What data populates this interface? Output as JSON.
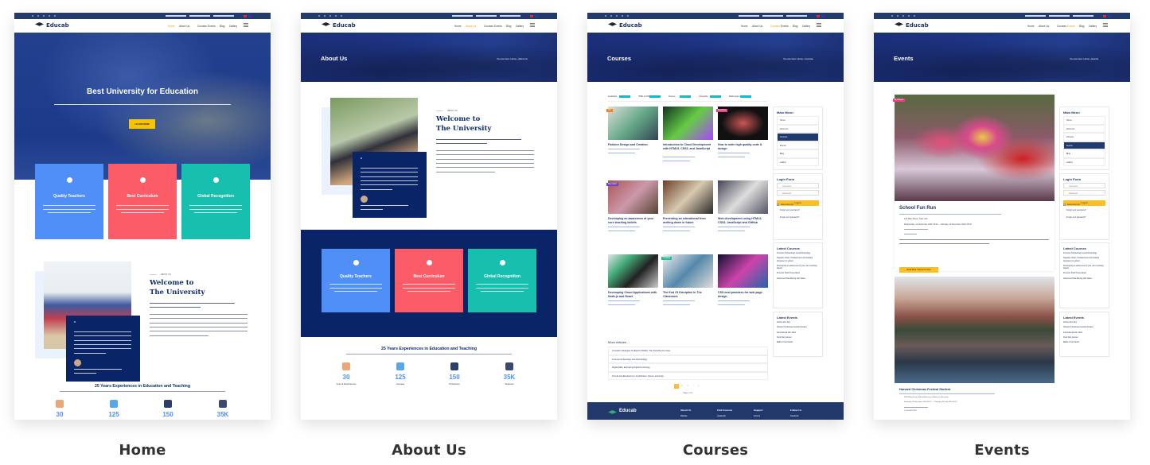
{
  "site": {
    "logo": "Educab",
    "nav": [
      "Home",
      "About Us",
      "Courses",
      "Events",
      "Blog",
      "Gallery"
    ],
    "colors": {
      "navy": "#233a6b",
      "dark_blue": "#0a2468",
      "accent_yellow": "#fbbf24",
      "blue": "#4f8ff7",
      "red": "#fb5c67",
      "teal": "#17bfae"
    }
  },
  "captions": [
    "Home",
    "About Us",
    "Courses",
    "Events"
  ],
  "features": [
    {
      "title": "Quality Teachers",
      "icon": "user-icon"
    },
    {
      "title": "Best Curriculum",
      "icon": "certificate-icon"
    },
    {
      "title": "Global Recognition",
      "icon": "globe-icon"
    }
  ],
  "home": {
    "hero_title": "Best University for Education",
    "hero_button": "LEARN MORE"
  },
  "welcome": {
    "eyebrow": "ABOUT US",
    "title_line1": "Welcome to",
    "title_line2": "The University"
  },
  "stats": {
    "heading": "25 Years Experiences in Education and Teaching",
    "items": [
      {
        "value": "30",
        "label": "Year of Experiences"
      },
      {
        "value": "125",
        "label": "Courses"
      },
      {
        "value": "150",
        "label": "Professors"
      },
      {
        "value": "35K",
        "label": "Students"
      }
    ]
  },
  "about": {
    "banner": "About Us",
    "breadcrumb": "You are here: Home › About Us"
  },
  "courses": {
    "banner": "Courses",
    "breadcrumb": "You are here: Home › Courses",
    "categories": [
      "JavaScript",
      "HTML & CSS",
      "Science",
      "Computing",
      "Mobile Apps"
    ],
    "cards": [
      {
        "title": "Fashion Design and Creation",
        "badge": "Hot"
      },
      {
        "title": "Introduction to Cloud Development with HTML5, CSS3, and JavaScript",
        "badge": ""
      },
      {
        "title": "How to write high quality code & design",
        "badge": "Best Price"
      },
      {
        "title": "Developing an awareness of your core teaching beliefs",
        "badge": "Best Seller"
      },
      {
        "title": "Preventing an educational from melting down in future",
        "badge": ""
      },
      {
        "title": "Web development using HTML5, CSS3, JavaScript and GitHub",
        "badge": ""
      },
      {
        "title": "Developing Cloud Applications with Node.js and React",
        "badge": ""
      },
      {
        "title": "The End Of Discipline in The Classroom",
        "badge": "Trending"
      },
      {
        "title": "CSS best practices for web page design",
        "badge": ""
      }
    ],
    "more_articles_title": "More Articles ...",
    "more_articles": [
      "Innovation Strategies for Electric Mobility: The Show/Service Case",
      "Forensic Archaeology and Anthropology",
      "Digital Skills: Embracing Digital Technology",
      "Circuits and Electronics 3: Amplification, Speed, and Delay"
    ],
    "pagination": [
      "1",
      "2",
      "3",
      "›",
      "»"
    ],
    "page_info": "Page 1 of 1",
    "footer": {
      "columns": [
        {
          "title": "About Us",
          "first": "Website"
        },
        {
          "title": "Find Courses",
          "first": "Javascript"
        },
        {
          "title": "Support",
          "first": "Forums"
        },
        {
          "title": "Follow Us",
          "first": "Facebook"
        }
      ]
    }
  },
  "sidebar": {
    "main_menu_title": "Main Menu",
    "menu": [
      "Home",
      "About Us",
      "Courses",
      "Events",
      "Blog",
      "Gallery"
    ],
    "login_title": "Login Form",
    "username_placeholder": "Username",
    "password_placeholder": "Password",
    "remember": "Remember Me",
    "login_button": "Log in",
    "forgot_username": "Forgot your username?",
    "forgot_password": "Forgot your password?",
    "latest_courses_title": "Latest Courses",
    "latest_courses": [
      "Forensic Archaeology and Anthropology",
      "Negative effect of harassment and bullying behaviour in school",
      "Developing an awareness of your core teaching beliefs",
      "Forensic Fluid Preservation",
      "Advanced Data Mining with Weka"
    ],
    "latest_events_title": "Latest Events",
    "latest_events": [
      "School Fun Run",
      "Harvard Christmas Festival Student",
      "International Fair 2022",
      "Field Day Games",
      "Battle of the bands"
    ]
  },
  "events": {
    "banner": "Events",
    "breadcrumb": "You are here: Home › Events",
    "items": [
      {
        "title": "School Fun Run",
        "badge": "Best Event",
        "address": "123 Main Street, New York",
        "date": "Wednesday, 21 December 2022 15:22 — Monday, 26 December 2022 15:22",
        "button": "Read More: School Fun Run"
      },
      {
        "title": "Harvard Christmas Festival Student",
        "badge": "",
        "address": "3204 Bling Street, Behind Ato Store, Melbourne, Australia",
        "date": "Saturday, 09 December 2028 09:27 — Thursday, 08 July 2022 09:27",
        "phone": "1-735-840-6799"
      }
    ]
  }
}
